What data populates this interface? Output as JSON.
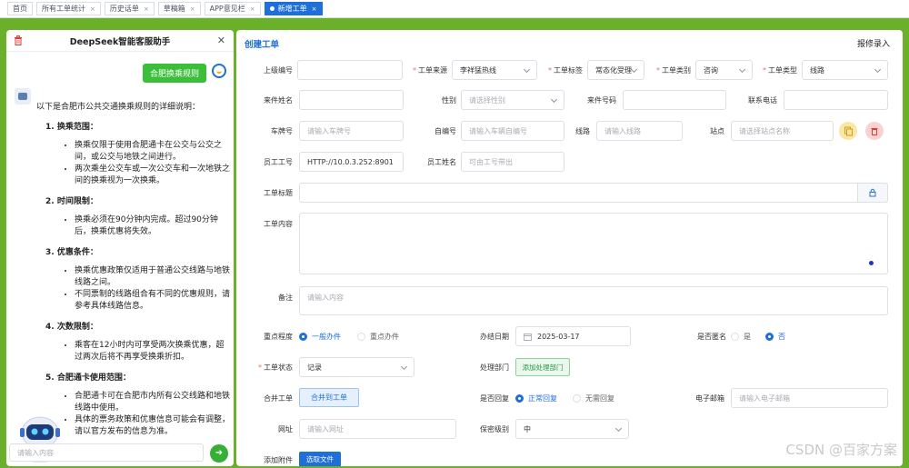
{
  "tabs": [
    {
      "label": "首页",
      "closable": false
    },
    {
      "label": "所有工单统计",
      "closable": true
    },
    {
      "label": "历史话单",
      "closable": true
    },
    {
      "label": "草稿箱",
      "closable": true
    },
    {
      "label": "APP意见栏",
      "closable": true
    },
    {
      "label": "新增工单",
      "closable": true,
      "active": true
    }
  ],
  "chat": {
    "title": "DeepSeek智能客服助手",
    "user_message": "合肥换乘规则",
    "intro": "以下是合肥市公共交通换乘规则的详细说明：",
    "sections": [
      {
        "title": "1. 换乘范围：",
        "items": [
          "换乘仅限于使用合肥通卡在公交与公交之间，或公交与地铁之间进行。",
          "两次乘坐公交车或一次公交车和一次地铁之间的换乘视为一次换乘。"
        ]
      },
      {
        "title": "2. 时间限制：",
        "items": [
          "换乘必须在90分钟内完成。超过90分钟后，换乘优惠将失效。"
        ]
      },
      {
        "title": "3. 优惠条件：",
        "items": [
          "换乘优惠政策仅适用于普通公交线路与地铁线路之间。",
          "不同票制的线路组合有不同的优惠规则，请参考具体线路信息。"
        ]
      },
      {
        "title": "4. 次数限制：",
        "items": [
          "乘客在12小时内可享受两次换乘优惠，超过两次后将不再享受换乘折扣。"
        ]
      },
      {
        "title": "5. 合肥通卡使用范围：",
        "items": [
          "合肥通卡可在合肥市内所有公交线路和地铁线路中使用。",
          "具体的票务政策和优惠信息可能会有调整，请以官方发布的信息为准。"
        ]
      }
    ],
    "input_placeholder": "请输入内容"
  },
  "form": {
    "title": "创建工单",
    "action": "报修录入",
    "fields": {
      "parent_no": {
        "label": "上级编号",
        "value": ""
      },
      "source": {
        "label": "工单来源",
        "value": "李祥猛热线"
      },
      "tag": {
        "label": "工单标签",
        "value": "常态化受理"
      },
      "category": {
        "label": "工单类别",
        "value": "咨询"
      },
      "type": {
        "label": "工单类型",
        "value": "线路"
      },
      "caller_name": {
        "label": "来件姓名",
        "value": ""
      },
      "gender": {
        "label": "性别",
        "placeholder": "请选择性别"
      },
      "caller_no": {
        "label": "来件号码",
        "value": ""
      },
      "phone": {
        "label": "联系电话",
        "value": ""
      },
      "plate": {
        "label": "车牌号",
        "placeholder": "请输入车牌号"
      },
      "self_no": {
        "label": "自编号",
        "placeholder": "请输入车辆自编号"
      },
      "line": {
        "label": "线路",
        "placeholder": "请输入线路"
      },
      "station": {
        "label": "站点",
        "placeholder": "请选择站点名称"
      },
      "emp_no": {
        "label": "员工工号",
        "value": "HTTP://10.0.3.252:8901"
      },
      "emp_name": {
        "label": "员工姓名",
        "placeholder": "可由工号带出"
      },
      "subject": {
        "label": "工单标题",
        "value": ""
      },
      "content": {
        "label": "工单内容",
        "value": ""
      },
      "remark": {
        "label": "备注",
        "placeholder": "请输入内容"
      },
      "priority": {
        "label": "重点程度",
        "options": [
          "一般办件",
          "重点办件"
        ],
        "selected": "一般办件"
      },
      "date": {
        "label": "办结日期",
        "value": "2025-03-17"
      },
      "anonymous": {
        "label": "是否匿名",
        "options": [
          "是",
          "否"
        ],
        "selected": "否"
      },
      "status": {
        "label": "工单状态",
        "value": "记录"
      },
      "dept": {
        "label": "处理部门",
        "button": "添加处理部门"
      },
      "merge": {
        "label": "合并工单",
        "button": "合并到工单"
      },
      "reply": {
        "label": "是否回复",
        "options": [
          "正常回复",
          "无需回复"
        ],
        "selected": "正常回复"
      },
      "email": {
        "label": "电子邮箱",
        "placeholder": "请输入电子邮箱"
      },
      "url": {
        "label": "网址",
        "placeholder": "请输入网址"
      },
      "secrecy": {
        "label": "保密级别",
        "value": "中"
      },
      "attach": {
        "label": "添加附件",
        "button": "选取文件"
      }
    }
  },
  "watermark": "CSDN @百家方案",
  "colors": {
    "accent": "#1e6fd9",
    "frame": "#6ab02a",
    "send": "#35b035",
    "danger": "#e53935"
  }
}
